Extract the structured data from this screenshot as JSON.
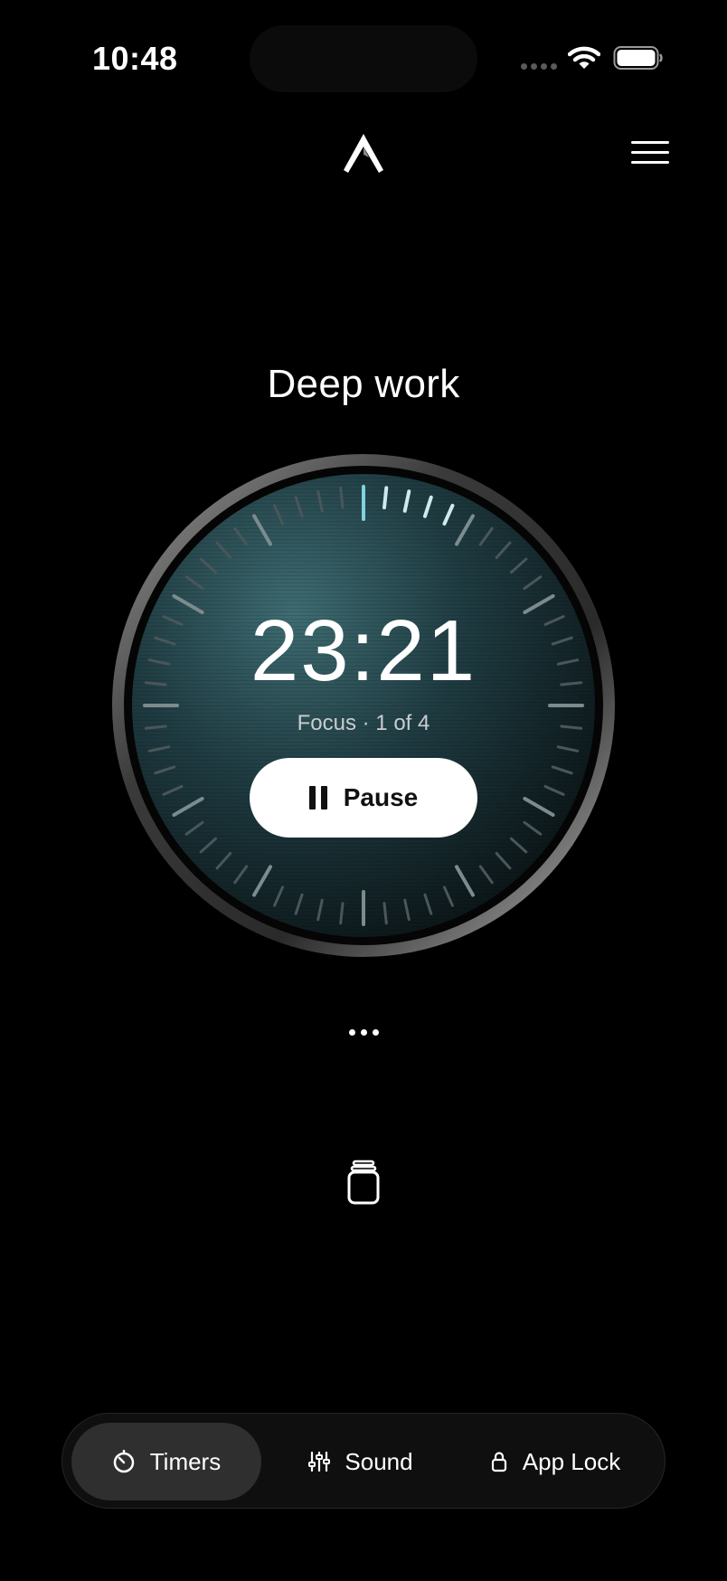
{
  "status_bar": {
    "time": "10:48"
  },
  "header": {
    "logo_icon": "chevron-logo-icon",
    "menu_icon": "hamburger-menu-icon"
  },
  "session": {
    "title": "Deep work",
    "time_remaining": "23:21",
    "subtitle": "Focus · 1 of 4",
    "pause_label": "Pause",
    "progress_fraction": 0.07
  },
  "more_icon": "ellipsis-icon",
  "jar_icon": "jar-icon",
  "tabs": [
    {
      "label": "Timers",
      "icon": "timer-icon",
      "active": true
    },
    {
      "label": "Sound",
      "icon": "sliders-icon",
      "active": false
    },
    {
      "label": "App Lock",
      "icon": "lock-icon",
      "active": false
    }
  ],
  "colors": {
    "accent": "#7fd3dc",
    "dial_face": "#1c3a40",
    "background": "#000000"
  }
}
